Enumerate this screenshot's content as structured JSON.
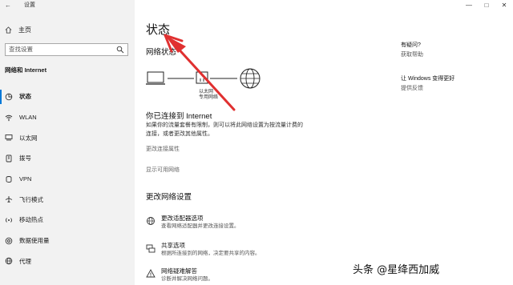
{
  "titlebar": {
    "back_icon": "back-arrow-icon",
    "app_title": "设置",
    "minimize": "—",
    "maximize": "□",
    "close": "✕"
  },
  "sidebar": {
    "home_label": "主页",
    "search_placeholder": "查找设置",
    "section_label": "网络和 Internet",
    "items": [
      {
        "label": "状态",
        "icon": "status-icon",
        "active": true
      },
      {
        "label": "WLAN",
        "icon": "wifi-icon",
        "active": false
      },
      {
        "label": "以太网",
        "icon": "ethernet-icon",
        "active": false
      },
      {
        "label": "拨号",
        "icon": "dialup-icon",
        "active": false
      },
      {
        "label": "VPN",
        "icon": "vpn-icon",
        "active": false
      },
      {
        "label": "飞行模式",
        "icon": "airplane-icon",
        "active": false
      },
      {
        "label": "移动热点",
        "icon": "hotspot-icon",
        "active": false
      },
      {
        "label": "数据使用量",
        "icon": "data-usage-icon",
        "active": false
      },
      {
        "label": "代理",
        "icon": "globe-icon",
        "active": false
      }
    ]
  },
  "main": {
    "title": "状态",
    "network_status_heading": "网络状态",
    "ethernet_name": "以太网",
    "network_name": "专用网络",
    "connected_title": "你已连接到 Internet",
    "connected_desc": "如果你的流量套餐有限制，则可以将此网络设置为按流量计费的连接，或者更改其他属性。",
    "change_properties_link": "更改连接属性",
    "show_networks_link": "显示可用网络",
    "change_settings_heading": "更改网络设置",
    "options": [
      {
        "title": "更改适配器选项",
        "desc": "查看网络适配器并更改连接设置。",
        "icon": "adapter-icon"
      },
      {
        "title": "共享选项",
        "desc": "根据所连接到的网络，决定要共享的内容。",
        "icon": "sharing-icon"
      },
      {
        "title": "网络疑难解答",
        "desc": "诊断并解决网络问题。",
        "icon": "troubleshoot-icon"
      }
    ]
  },
  "right": {
    "question_title": "有疑问?",
    "question_link": "获取帮助",
    "improve_title": "让 Windows 变得更好",
    "improve_link": "提供反馈"
  },
  "annotation_color": "#e03030",
  "accent_color": "#0078d7",
  "watermark": "头条 @星绛西加威"
}
